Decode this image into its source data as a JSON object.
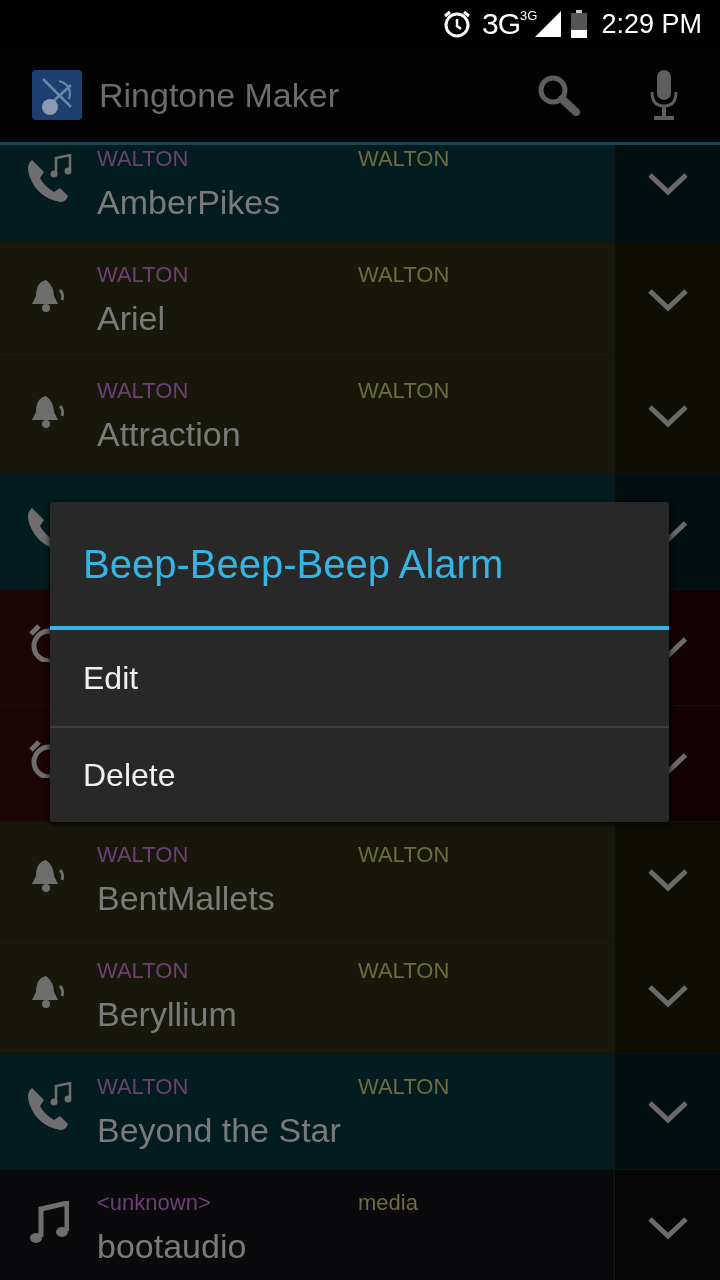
{
  "status_bar": {
    "network": "3G",
    "network_badge": "3G",
    "time": "2:29 PM"
  },
  "app_bar": {
    "title": "Ringtone Maker"
  },
  "rows": [
    {
      "kind": "ringtone",
      "artist": "WALTON",
      "album": "WALTON",
      "name": "AmberPikes"
    },
    {
      "kind": "notification",
      "artist": "WALTON",
      "album": "WALTON",
      "name": "Ariel"
    },
    {
      "kind": "notification",
      "artist": "WALTON",
      "album": "WALTON",
      "name": "Attraction"
    },
    {
      "kind": "ringtone"
    },
    {
      "kind": "alarm"
    },
    {
      "kind": "alarm"
    },
    {
      "kind": "notification",
      "artist": "WALTON",
      "album": "WALTON",
      "name": "BentMallets"
    },
    {
      "kind": "notification",
      "artist": "WALTON",
      "album": "WALTON",
      "name": "Beryllium"
    },
    {
      "kind": "ringtone",
      "artist": "WALTON",
      "album": "WALTON",
      "name": "Beyond the Star"
    },
    {
      "kind": "music",
      "artist": "<unknown>",
      "album": "media",
      "name": "bootaudio"
    }
  ],
  "dialog": {
    "title": "Beep-Beep-Beep Alarm",
    "items": [
      "Edit",
      "Delete"
    ]
  }
}
